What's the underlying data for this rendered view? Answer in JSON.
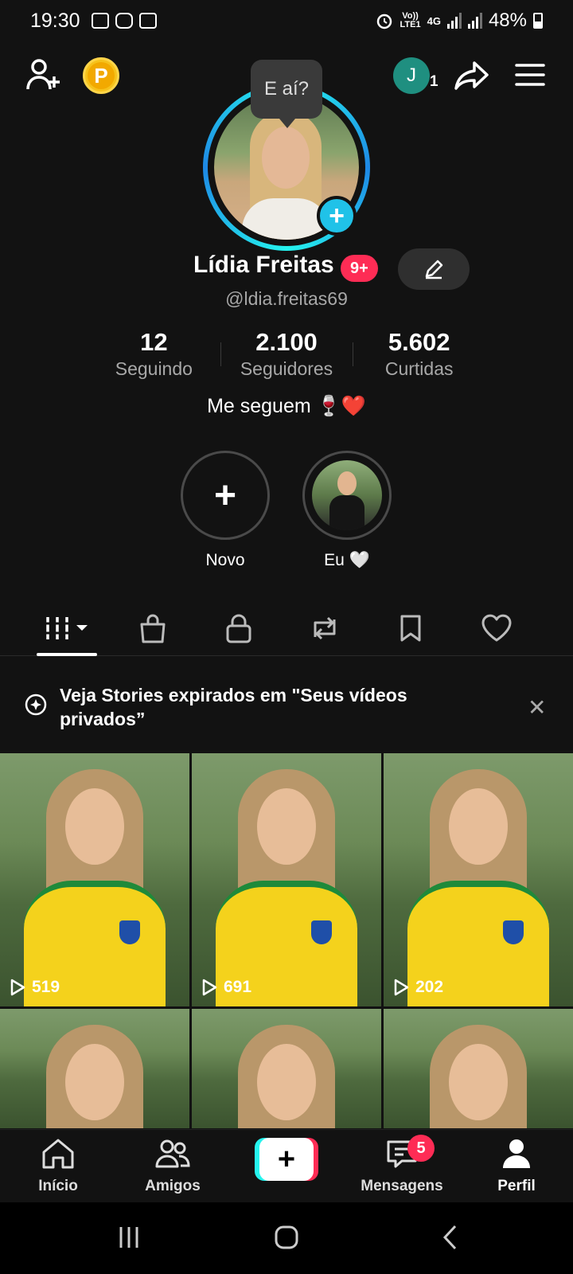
{
  "status_bar": {
    "time": "19:30",
    "volte_label": "Vo))",
    "lte_label": "LTE1",
    "network": "4G",
    "battery": "48%"
  },
  "header": {
    "tooltip": "E aí?",
    "coin_label": "P",
    "avatar_initial": "J",
    "avatar_count": "1"
  },
  "profile": {
    "name": "Lídia Freitas",
    "notification_badge": "9+",
    "handle": "@ldia.freitas69",
    "bio": "Me seguem 🍷❤️"
  },
  "stats": [
    {
      "value": "12",
      "label": "Seguindo"
    },
    {
      "value": "2.100",
      "label": "Seguidores"
    },
    {
      "value": "5.602",
      "label": "Curtidas"
    }
  ],
  "highlights": [
    {
      "label": "Novo"
    },
    {
      "label": "Eu 🤍"
    }
  ],
  "tabs": [
    "videos",
    "shop",
    "private",
    "reposts",
    "saved",
    "liked"
  ],
  "banner": {
    "text": "Veja Stories expirados em \"Seus vídeos privados”",
    "close": "✕"
  },
  "videos": [
    {
      "views": "519"
    },
    {
      "views": "691"
    },
    {
      "views": "202"
    },
    {
      "views": ""
    },
    {
      "views": ""
    },
    {
      "views": ""
    }
  ],
  "bottom_nav": {
    "home": "Início",
    "friends": "Amigos",
    "messages": "Mensagens",
    "messages_badge": "5",
    "profile": "Perfil"
  },
  "colors": {
    "background": "#121212",
    "accent_pink": "#fe2c55",
    "accent_cyan": "#25f4ee",
    "coin": "#f6c21b"
  }
}
